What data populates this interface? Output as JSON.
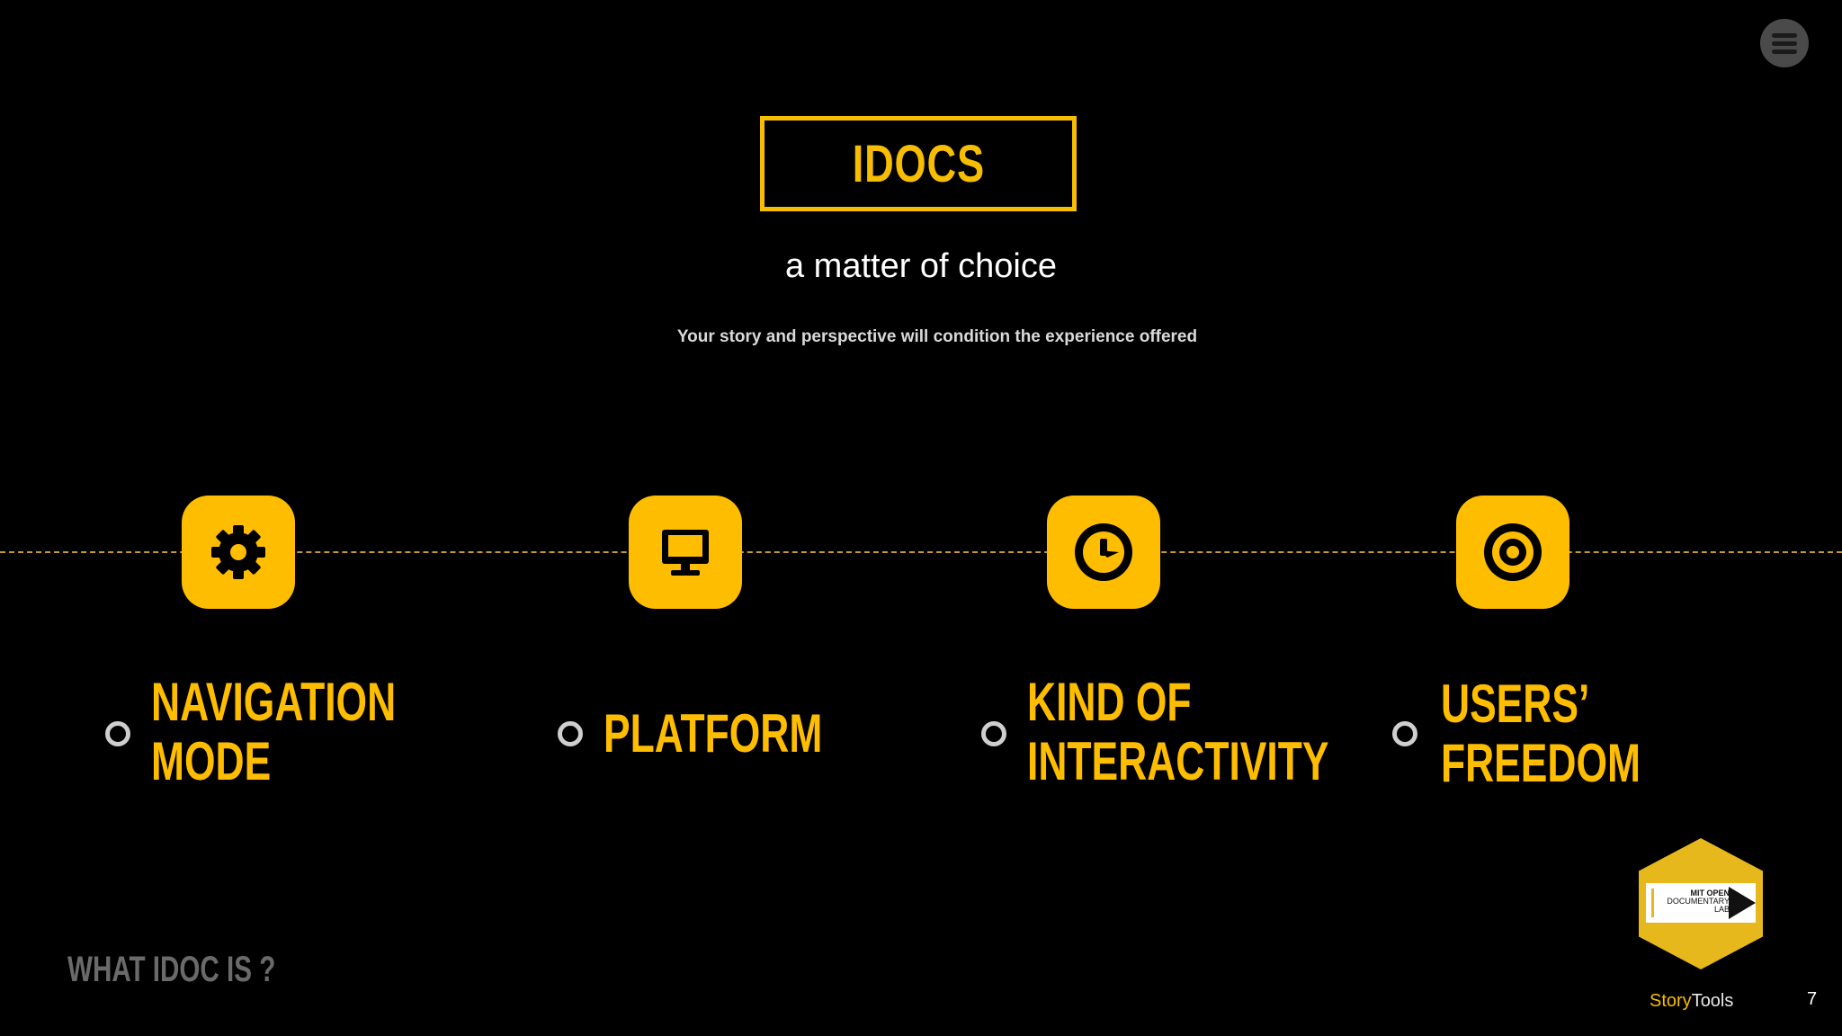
{
  "menu": {
    "icon": "hamburger-menu-icon"
  },
  "title": "IDOCS",
  "subtitle": "a matter of choice",
  "description": "Your story and perspective will condition the experience offered",
  "options": [
    {
      "icon": "gear-icon",
      "line1": "NAVIGATION",
      "line2": "MODE"
    },
    {
      "icon": "monitor-icon",
      "line1": "PLATFORM",
      "line2": ""
    },
    {
      "icon": "clock-icon",
      "line1": "KIND OF",
      "line2": "INTERACTIVITY"
    },
    {
      "icon": "target-icon",
      "line1": "USERS’",
      "line2": "FREEDOM"
    }
  ],
  "section": "WHAT IDOC IS ?",
  "logo": {
    "line1": "MIT OPEN",
    "line2": "DOCUMENTARY",
    "line3": "LAB"
  },
  "brand": {
    "part1": "Story",
    "part2": "Tools"
  },
  "page_number": "7",
  "colors": {
    "accent": "#ffbd00",
    "background": "#000000",
    "muted": "#6a6a6a"
  }
}
